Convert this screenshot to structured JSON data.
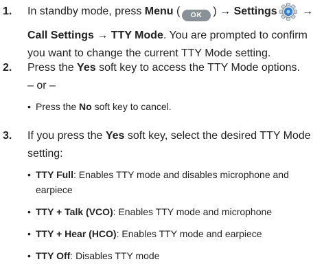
{
  "step1": {
    "number": "1.",
    "l1_a": "In standby mode, press ",
    "menu": "Menu",
    "paren_open": " (",
    "ok_key": "OK",
    "paren_close": ") ",
    "arrow1": "→ ",
    "settings": "Settings",
    "arrow2": " →",
    "l2_call_settings": "Call Settings",
    "l2_arrow": " → ",
    "l2_tty_mode": "TTY Mode",
    "l2_rest": ". You are prompted to confirm",
    "l3": "you want to change the current TTY Mode setting."
  },
  "step2": {
    "number": "2.",
    "l1_a": "Press the ",
    "yes": "Yes",
    "l1_b": " soft key to access the TTY Mode options.",
    "or": "– or –",
    "bullet_a": "Press the ",
    "no": "No",
    "bullet_b": " soft key to cancel."
  },
  "step3": {
    "number": "3.",
    "l1_a": "If you press the ",
    "yes": "Yes",
    "l1_b": " soft key, select the desired TTY Mode",
    "l2": "setting:",
    "options": [
      {
        "name": "TTY Full",
        "desc": ": Enables TTY mode and disables microphone and",
        "desc2": "earpiece"
      },
      {
        "name": "TTY + Talk (VCO)",
        "desc": ": Enables TTY mode and microphone"
      },
      {
        "name": "TTY + Hear (HCO)",
        "desc": ": Enables TTY mode and earpiece"
      },
      {
        "name": "TTY Off",
        "desc": ": Disables TTY mode"
      }
    ]
  },
  "bullet_char": "•",
  "icons": {
    "ok_key": "ok-key-icon",
    "settings": "settings-gear-icon"
  },
  "colors": {
    "text": "#222222",
    "ok_key_bg": "#8a9196",
    "gear_blue": "#2f7fc9"
  }
}
